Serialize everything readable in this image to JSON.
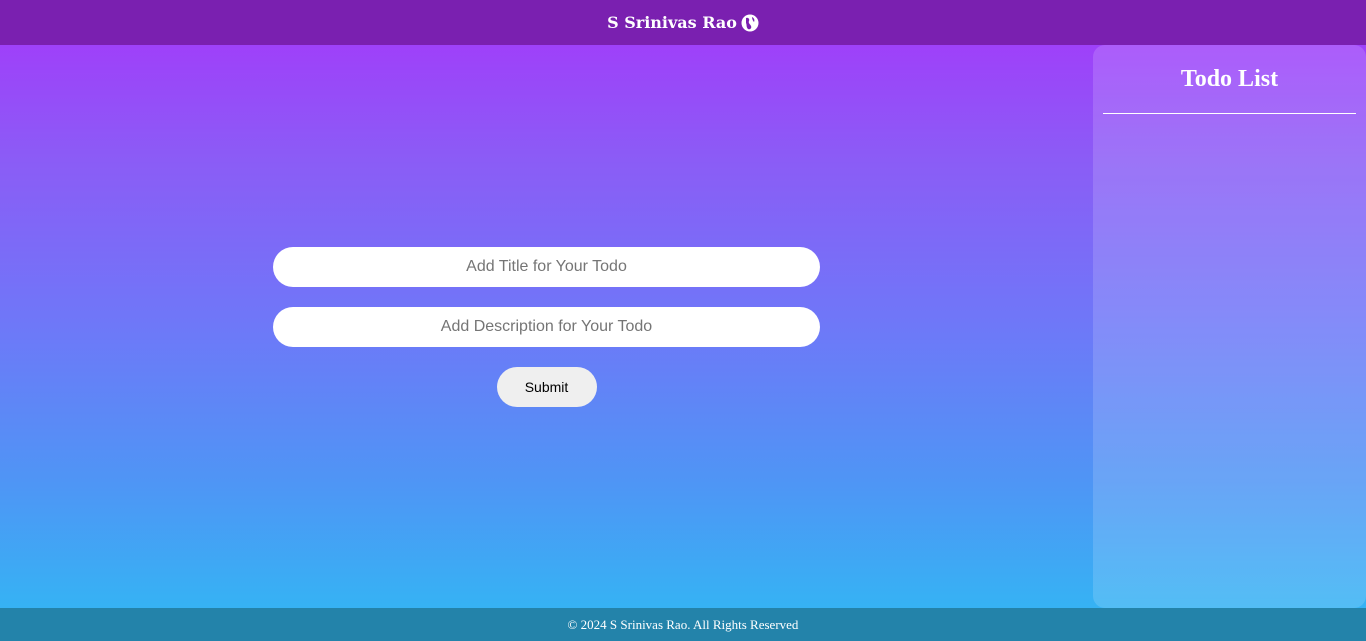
{
  "header": {
    "brand_name": "S Srinivas Rao",
    "logo_icon": "globe-hand-icon",
    "background_color": "#7a20b0"
  },
  "form": {
    "title_placeholder": "Add Title for Your Todo",
    "title_value": "",
    "description_placeholder": "Add Description for Your Todo",
    "description_value": "",
    "submit_label": "Submit"
  },
  "todo_panel": {
    "title": "Todo List",
    "items": []
  },
  "footer": {
    "text": "© 2024 S Srinivas Rao. All Rights Reserved",
    "background_color": "#2383aa"
  },
  "theme": {
    "gradient_top": "#a636fb",
    "gradient_bottom": "#2fbaf4"
  }
}
